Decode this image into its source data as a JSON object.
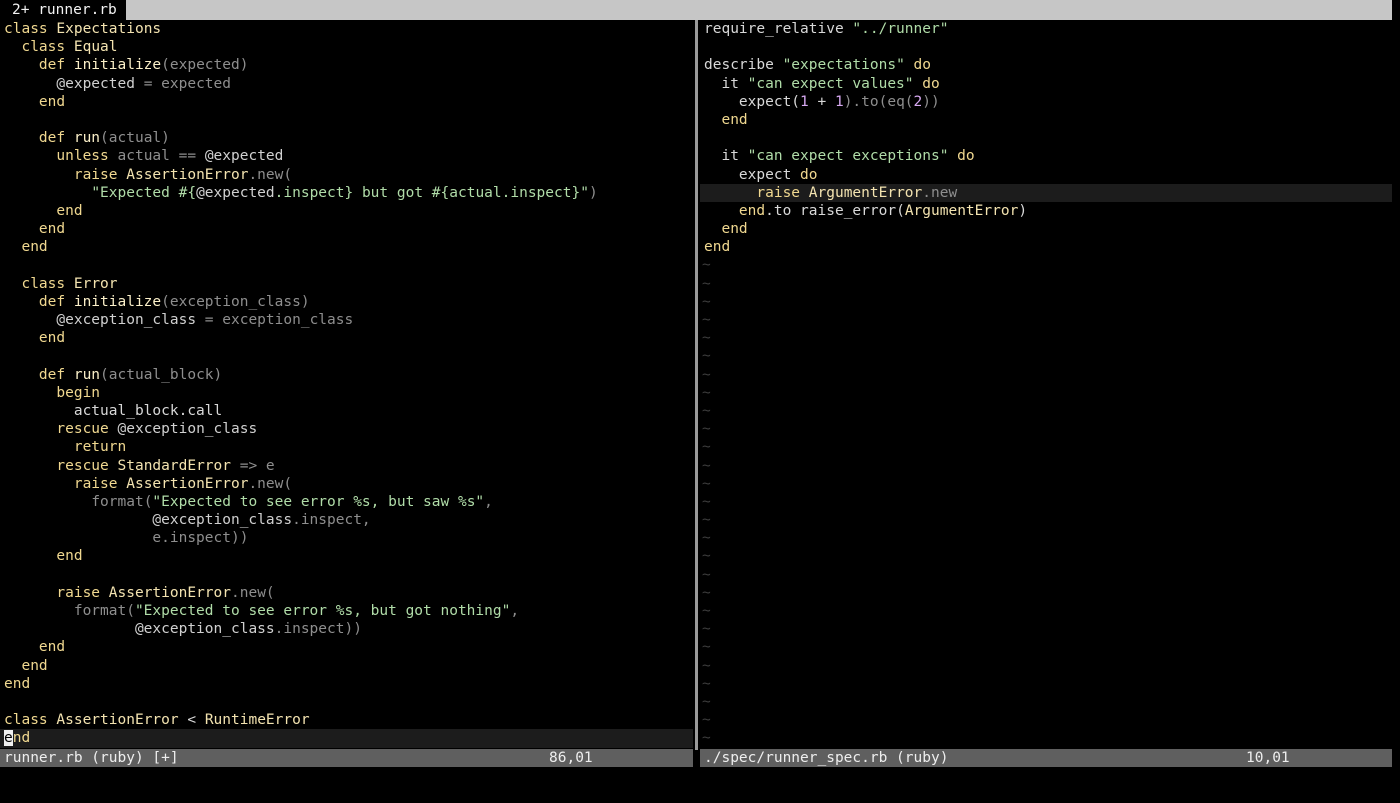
{
  "tabline": {
    "active_tab": "2+ runner.rb"
  },
  "left_pane": {
    "lines": [
      [
        [
          "kw",
          "class "
        ],
        [
          "cn",
          "Expectations"
        ]
      ],
      [
        [
          "pl",
          "  "
        ],
        [
          "kw",
          "class "
        ],
        [
          "cn",
          "Equal"
        ]
      ],
      [
        [
          "pl",
          "    "
        ],
        [
          "kw",
          "def "
        ],
        [
          "fn",
          "initialize"
        ],
        [
          "dm",
          "(expected)"
        ]
      ],
      [
        [
          "pl",
          "      "
        ],
        [
          "iv",
          "@expected"
        ],
        [
          "dm",
          " = expected"
        ]
      ],
      [
        [
          "pl",
          "    "
        ],
        [
          "kw",
          "end"
        ]
      ],
      [],
      [
        [
          "pl",
          "    "
        ],
        [
          "kw",
          "def "
        ],
        [
          "fn",
          "run"
        ],
        [
          "dm",
          "(actual)"
        ]
      ],
      [
        [
          "pl",
          "      "
        ],
        [
          "kw",
          "unless "
        ],
        [
          "dm",
          "actual == "
        ],
        [
          "iv",
          "@expected"
        ]
      ],
      [
        [
          "pl",
          "        "
        ],
        [
          "kw",
          "raise "
        ],
        [
          "cn",
          "AssertionError"
        ],
        [
          "dm",
          ".new("
        ]
      ],
      [
        [
          "pl",
          "          "
        ],
        [
          "st",
          "\"Expected #{"
        ],
        [
          "iv",
          "@expected"
        ],
        [
          "st",
          ".inspect} but got #{actual.inspect}\""
        ],
        [
          "dm",
          ")"
        ]
      ],
      [
        [
          "pl",
          "      "
        ],
        [
          "kw",
          "end"
        ]
      ],
      [
        [
          "pl",
          "    "
        ],
        [
          "kw",
          "end"
        ]
      ],
      [
        [
          "pl",
          "  "
        ],
        [
          "kw",
          "end"
        ]
      ],
      [],
      [
        [
          "pl",
          "  "
        ],
        [
          "kw",
          "class "
        ],
        [
          "cn",
          "Error"
        ]
      ],
      [
        [
          "pl",
          "    "
        ],
        [
          "kw",
          "def "
        ],
        [
          "fn",
          "initialize"
        ],
        [
          "dm",
          "(exception_class)"
        ]
      ],
      [
        [
          "pl",
          "      "
        ],
        [
          "iv",
          "@exception_class"
        ],
        [
          "dm",
          " = exception_class"
        ]
      ],
      [
        [
          "pl",
          "    "
        ],
        [
          "kw",
          "end"
        ]
      ],
      [],
      [
        [
          "pl",
          "    "
        ],
        [
          "kw",
          "def "
        ],
        [
          "fn",
          "run"
        ],
        [
          "dm",
          "(actual_block)"
        ]
      ],
      [
        [
          "pl",
          "      "
        ],
        [
          "kw",
          "begin"
        ]
      ],
      [
        [
          "pl",
          "        actual_block.call"
        ]
      ],
      [
        [
          "pl",
          "      "
        ],
        [
          "kw",
          "rescue "
        ],
        [
          "iv",
          "@exception_class"
        ]
      ],
      [
        [
          "pl",
          "        "
        ],
        [
          "kw",
          "return"
        ]
      ],
      [
        [
          "pl",
          "      "
        ],
        [
          "kw",
          "rescue "
        ],
        [
          "cn",
          "StandardError"
        ],
        [
          "dm",
          " => e"
        ]
      ],
      [
        [
          "pl",
          "        "
        ],
        [
          "kw",
          "raise "
        ],
        [
          "cn",
          "AssertionError"
        ],
        [
          "dm",
          ".new("
        ]
      ],
      [
        [
          "pl",
          "          "
        ],
        [
          "dm",
          "format("
        ],
        [
          "st",
          "\"Expected to see error %s, but saw %s\""
        ],
        [
          "dm",
          ","
        ]
      ],
      [
        [
          "pl",
          "                 "
        ],
        [
          "iv",
          "@exception_class"
        ],
        [
          "dm",
          ".inspect,"
        ]
      ],
      [
        [
          "pl",
          "                 "
        ],
        [
          "dm",
          "e.inspect))"
        ]
      ],
      [
        [
          "pl",
          "      "
        ],
        [
          "kw",
          "end"
        ]
      ],
      [],
      [
        [
          "pl",
          "      "
        ],
        [
          "kw",
          "raise "
        ],
        [
          "cn",
          "AssertionError"
        ],
        [
          "dm",
          ".new("
        ]
      ],
      [
        [
          "pl",
          "        "
        ],
        [
          "dm",
          "format("
        ],
        [
          "st",
          "\"Expected to see error %s, but got nothing\""
        ],
        [
          "dm",
          ","
        ]
      ],
      [
        [
          "pl",
          "               "
        ],
        [
          "iv",
          "@exception_class"
        ],
        [
          "dm",
          ".inspect))"
        ]
      ],
      [
        [
          "pl",
          "    "
        ],
        [
          "kw",
          "end"
        ]
      ],
      [
        [
          "pl",
          "  "
        ],
        [
          "kw",
          "end"
        ]
      ],
      [
        [
          "kw",
          "end"
        ]
      ],
      [],
      [
        [
          "kw",
          "class "
        ],
        [
          "cn",
          "AssertionError"
        ],
        [
          "pl",
          " < "
        ],
        [
          "cn",
          "RuntimeError"
        ]
      ],
      [
        [
          "cursor",
          "e"
        ],
        [
          "kw",
          "nd"
        ]
      ]
    ],
    "cursor_line": 39
  },
  "right_pane": {
    "lines": [
      [
        [
          "pl",
          "require_relative "
        ],
        [
          "st",
          "\"../runner\""
        ]
      ],
      [],
      [
        [
          "pl",
          "describe "
        ],
        [
          "st",
          "\"expectations\""
        ],
        [
          "kw",
          " do"
        ]
      ],
      [
        [
          "pl",
          "  it "
        ],
        [
          "st",
          "\"can expect values\""
        ],
        [
          "kw",
          " do"
        ]
      ],
      [
        [
          "pl",
          "    expect("
        ],
        [
          "nu",
          "1"
        ],
        [
          "pl",
          " + "
        ],
        [
          "nu",
          "1"
        ],
        [
          "dm",
          ").to(eq("
        ],
        [
          "nu",
          "2"
        ],
        [
          "dm",
          "))"
        ]
      ],
      [
        [
          "pl",
          "  "
        ],
        [
          "kw",
          "end"
        ]
      ],
      [],
      [
        [
          "pl",
          "  it "
        ],
        [
          "st",
          "\"can expect exceptions\""
        ],
        [
          "kw",
          " do"
        ]
      ],
      [
        [
          "pl",
          "    expect "
        ],
        [
          "kw",
          "do"
        ]
      ],
      [
        [
          "pl",
          "      "
        ],
        [
          "kw",
          "raise "
        ],
        [
          "cn",
          "ArgumentError"
        ],
        [
          "dm",
          ".new"
        ]
      ],
      [
        [
          "pl",
          "    "
        ],
        [
          "kw",
          "end"
        ],
        [
          "pl",
          ".to raise_error("
        ],
        [
          "cn",
          "ArgumentError"
        ],
        [
          "pl",
          ")"
        ]
      ],
      [
        [
          "pl",
          "  "
        ],
        [
          "kw",
          "end"
        ]
      ],
      [
        [
          "kw",
          "end"
        ]
      ]
    ],
    "cursor_line": 9,
    "tilde": "~"
  },
  "status": {
    "left": {
      "filename": "runner.rb (ruby) [+]",
      "position": "86,01"
    },
    "right": {
      "filename": "./spec/runner_spec.rb (ruby)",
      "position": "10,01"
    }
  },
  "colors": {
    "keyword": "#f0d890",
    "constant": "#f3e3b0",
    "string": "#b0dca8",
    "number": "#d6a8f0",
    "statusline": "#5f5f5f",
    "tabline": "#c6c6c6"
  }
}
